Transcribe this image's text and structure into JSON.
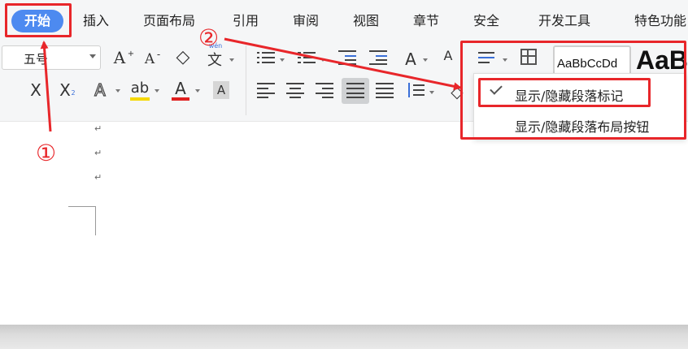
{
  "menu": {
    "tabs": [
      "开始",
      "插入",
      "页面布局",
      "引用",
      "审阅",
      "视图",
      "章节",
      "安全",
      "开发工具",
      "特色功能"
    ]
  },
  "ribbon": {
    "font_size": "五号",
    "grow_font_glyph": "A",
    "shrink_font_glyph": "A",
    "clear_format_glyph": "◇",
    "pinyin_glyph": "文",
    "pinyin_small": "wén",
    "bold_glyph": "A",
    "font_color_glyph": "A",
    "highlight_glyph": "ab",
    "char_shade_glyph": "A",
    "strike_glyph": "X",
    "subscript_glyph": "X",
    "subscript_small": "2",
    "style_sample_small": "AaBbCcDd",
    "style_sample_large": "AaB"
  },
  "dropdown": {
    "items": [
      {
        "label": "显示/隐藏段落标记",
        "checked": true
      },
      {
        "label": "显示/隐藏段落布局按钮",
        "checked": false
      }
    ]
  },
  "document": {
    "paragraph_marks": [
      "↵",
      "↵",
      "↵"
    ]
  },
  "annotations": {
    "step1": "①",
    "step2": "②"
  },
  "colors": {
    "active_tab": "#4d8af0",
    "annotation_red": "#e8262a",
    "highlight_yellow": "#f5d800",
    "font_color_red": "#e02020"
  }
}
